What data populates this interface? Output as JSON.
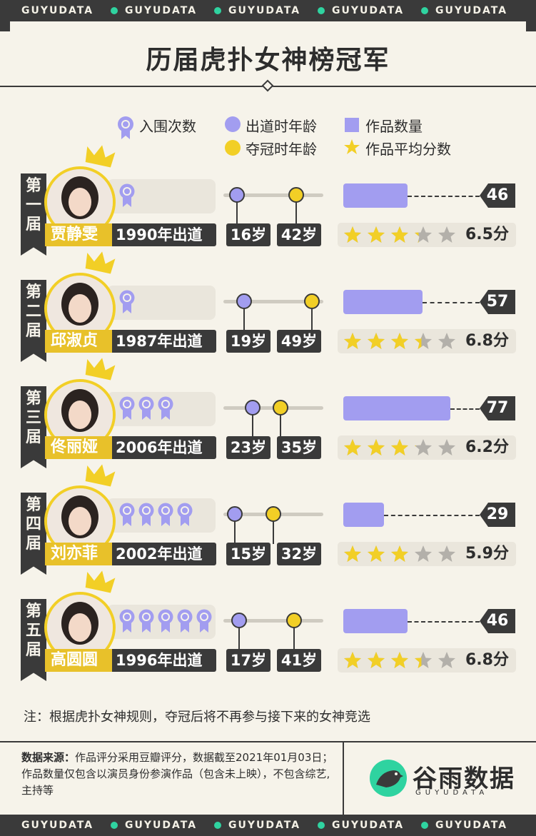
{
  "brand": {
    "band_text": "GUYUDATA",
    "accent": "#2fd3a0"
  },
  "title": "历届虎扑女神榜冠军",
  "legend": {
    "nominations": "入围次数",
    "debut_age": "出道时年龄",
    "works": "作品数量",
    "win_age": "夺冠时年龄",
    "avg_score": "作品平均分数"
  },
  "colors": {
    "purple": "#a29df0",
    "yellow": "#f2cf26",
    "dark": "#3a3a3a",
    "gold": "#e8c12a"
  },
  "chart_data": {
    "type": "table",
    "rows": [
      {
        "rank": "第一届",
        "name": "贾静雯",
        "debut": "1990年出道",
        "nominations": 1,
        "debut_age": 16,
        "debut_age_label": "16岁",
        "win_age": 42,
        "win_age_label": "42岁",
        "works": 46,
        "works_label": "46",
        "score": 6.5,
        "score_label": "6.5分",
        "stars": 3.25
      },
      {
        "rank": "第二届",
        "name": "邱淑贞",
        "debut": "1987年出道",
        "nominations": 1,
        "debut_age": 19,
        "debut_age_label": "19岁",
        "win_age": 49,
        "win_age_label": "49岁",
        "works": 57,
        "works_label": "57",
        "score": 6.8,
        "score_label": "6.8分",
        "stars": 3.4
      },
      {
        "rank": "第三届",
        "name": "佟丽娅",
        "debut": "2006年出道",
        "nominations": 3,
        "debut_age": 23,
        "debut_age_label": "23岁",
        "win_age": 35,
        "win_age_label": "35岁",
        "works": 77,
        "works_label": "77",
        "score": 6.2,
        "score_label": "6.2分",
        "stars": 3.1
      },
      {
        "rank": "第四届",
        "name": "刘亦菲",
        "debut": "2002年出道",
        "nominations": 4,
        "debut_age": 15,
        "debut_age_label": "15岁",
        "win_age": 32,
        "win_age_label": "32岁",
        "works": 29,
        "works_label": "29",
        "score": 5.9,
        "score_label": "5.9分",
        "stars": 2.95
      },
      {
        "rank": "第五届",
        "name": "高圆圆",
        "debut": "1996年出道",
        "nominations": 5,
        "debut_age": 17,
        "debut_age_label": "17岁",
        "win_age": 41,
        "win_age_label": "41岁",
        "works": 46,
        "works_label": "46",
        "score": 6.8,
        "score_label": "6.8分",
        "stars": 3.4
      }
    ]
  },
  "note": "注：根据虎扑女神规则，夺冠后将不再参与接下来的女神竞选",
  "source": {
    "label": "数据来源：",
    "text": "作品评分采用豆瓣评分，数据截至2021年01月03日；作品数量仅包含以演员身份参演作品（包含未上映），不包含综艺,主持等"
  },
  "logo": {
    "name": "谷雨数据",
    "sub": "GUYUDATA"
  }
}
